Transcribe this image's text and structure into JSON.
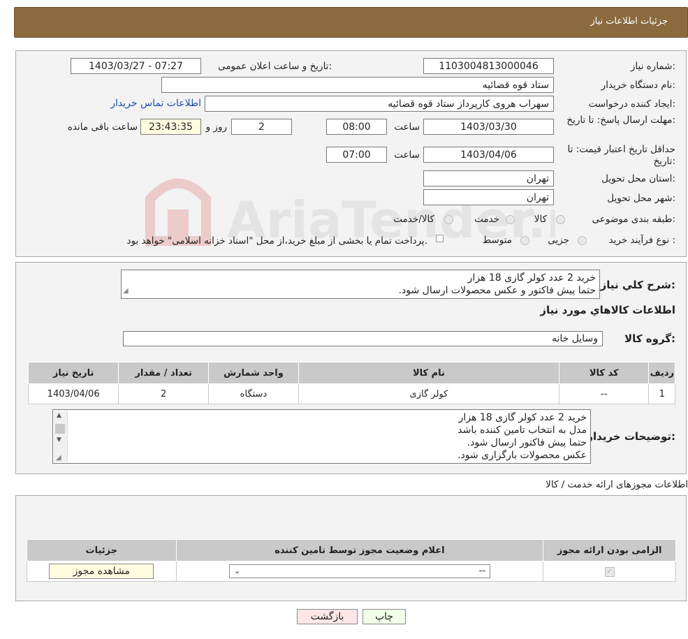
{
  "header": {
    "title": "جزئیات اطلاعات نیاز"
  },
  "form": {
    "need_number_label": "شماره نیاز:",
    "need_number": "1103004813000046",
    "announce_label": "تاریخ و ساعت اعلان عمومی:",
    "announce_value": "1403/03/27 - 07:27",
    "buyer_org_label": "نام دستگاه خریدار:",
    "buyer_org": "ستاد قوه قضائیه",
    "creator_label": "ایجاد کننده درخواست:",
    "creator": "سهراب هروی کارپرداز ستاد قوه قضائیه",
    "contact_link": "اطلاعات تماس خریدار",
    "deadline_label": "مهلت ارسال پاسخ: تا تاریخ:",
    "deadline_date": "1403/03/30",
    "time_label": "ساعت",
    "deadline_time": "08:00",
    "days": "2",
    "days_label": "روز و",
    "remaining": "23:43:35",
    "remaining_label": "ساعت باقی مانده",
    "validity_label": "حداقل تاریخ اعتبار قیمت: تا تاریخ:",
    "validity_date": "1403/04/06",
    "validity_time": "07:00",
    "province_label": "استان محل تحویل:",
    "province": "تهران",
    "city_label": "شهر محل تحویل:",
    "city": "تهران",
    "category_label": "طبقه بندی موضوعی:",
    "category_options": [
      "کالا",
      "خدمت",
      "کالا/خدمت"
    ],
    "process_label": "نوع فرآیند خرید :",
    "process_options": [
      "جزیی",
      "متوسط"
    ],
    "process_note": "پرداخت تمام یا بخشی از مبلغ خرید،از محل \"اسناد خزانه اسلامی\" خواهد بود."
  },
  "summary": {
    "label": "شرح كلي نياز:",
    "line1": "خرید 2 عدد کولر گازی 18 هزار",
    "line2": "حتما پیش فاکتور و عکس محصولات ارسال شود.",
    "goods_title": "اطلاعات کالاهاي مورد نياز",
    "group_label": "گروه کالا:",
    "group_value": "وسایل خانه"
  },
  "goods_table": {
    "headers": [
      "ردیف",
      "کد کالا",
      "نام کالا",
      "واحد شمارش",
      "تعداد / مقدار",
      "تاریخ نیاز"
    ],
    "row": [
      "1",
      "--",
      "کولر گازی",
      "دستگاه",
      "2",
      "1403/04/06"
    ]
  },
  "buyer_notes": {
    "label": "توضیحات خریدار:",
    "lines": [
      "خرید 2 عدد کولر گازی 18 هزار",
      "مدل به انتخاب تامین کننده باشد",
      "حتما پیش فاکتور ارسال شود.",
      "عکس محصولات بارگزاری شود."
    ]
  },
  "permits": {
    "title": "اطلاعات مجوزهای ارائه خدمت / کالا",
    "headers": [
      "الزامی بودن ارائه مجوز",
      "اعلام وضعیت مجوز توسط تامین کننده",
      "جزئیات"
    ],
    "select_value": "--",
    "view_button": "مشاهده مجوز"
  },
  "buttons": {
    "print": "چاپ",
    "back": "بازگشت"
  },
  "watermark": {
    "text": "AriaTender.neT"
  },
  "colors": {
    "header_bg": "#8b6a3e",
    "link": "#1a4fb5",
    "print_bg": "#f0ffe8",
    "back_bg": "#ffe6e6"
  }
}
